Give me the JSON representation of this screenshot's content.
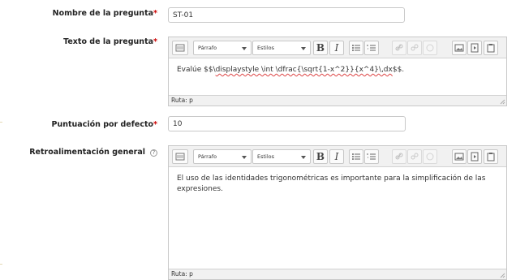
{
  "form": {
    "question_name": {
      "label": "Nombre de la pregunta",
      "value": "ST-01"
    },
    "question_text": {
      "label": "Texto de la pregunta"
    },
    "default_mark": {
      "label": "Puntuación por defecto",
      "value": "10"
    },
    "general_feedback": {
      "label": "Retroalimentación general"
    },
    "required_marker": "*",
    "help_icon_glyph": "?"
  },
  "editors": {
    "question_text": {
      "content_prefix": "Evalúe $$\\",
      "content_math": "displaystyle \\int \\dfrac{\\sqrt{1-x^2}}{x^4}\\,dx",
      "content_suffix": "$$.",
      "path": "Ruta: p"
    },
    "general_feedback": {
      "content": "El uso de las identidades trigonométricas es importante para la simplificación de las expresiones.",
      "path": "Ruta: p"
    }
  },
  "toolbar": {
    "paragraph_format": "Párrafo",
    "styles": "Estilos",
    "bold": "B",
    "italic": "I",
    "icons": [
      "toolbar-toggle-icon",
      "unordered-list-icon",
      "ordered-list-icon",
      "link-icon",
      "unlink-icon",
      "nolink-icon",
      "image-icon",
      "media-icon",
      "paste-icon"
    ]
  }
}
